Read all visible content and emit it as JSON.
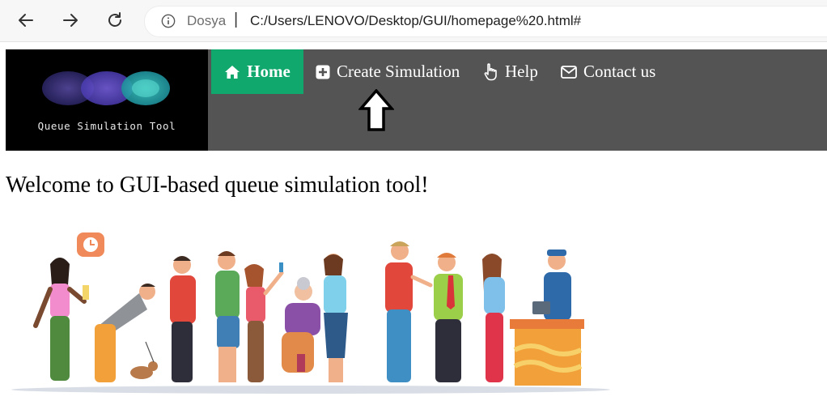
{
  "browser": {
    "site_label": "Dosya",
    "separator": "|",
    "url": "C:/Users/LENOVO/Desktop/GUI/homepage%20.html#"
  },
  "logo": {
    "title": "Queue Simulation Tool"
  },
  "nav": {
    "items": [
      {
        "label": "Home",
        "icon": "home-icon",
        "active": true
      },
      {
        "label": "Create Simulation",
        "icon": "plus-square-icon"
      },
      {
        "label": "Help",
        "icon": "hand-pointer-icon"
      },
      {
        "label": "Contact us",
        "icon": "envelope-icon"
      }
    ],
    "accent_color": "#10a86c",
    "bar_color": "#545454"
  },
  "main": {
    "welcome": "Welcome to GUI-based queue simulation tool!"
  }
}
